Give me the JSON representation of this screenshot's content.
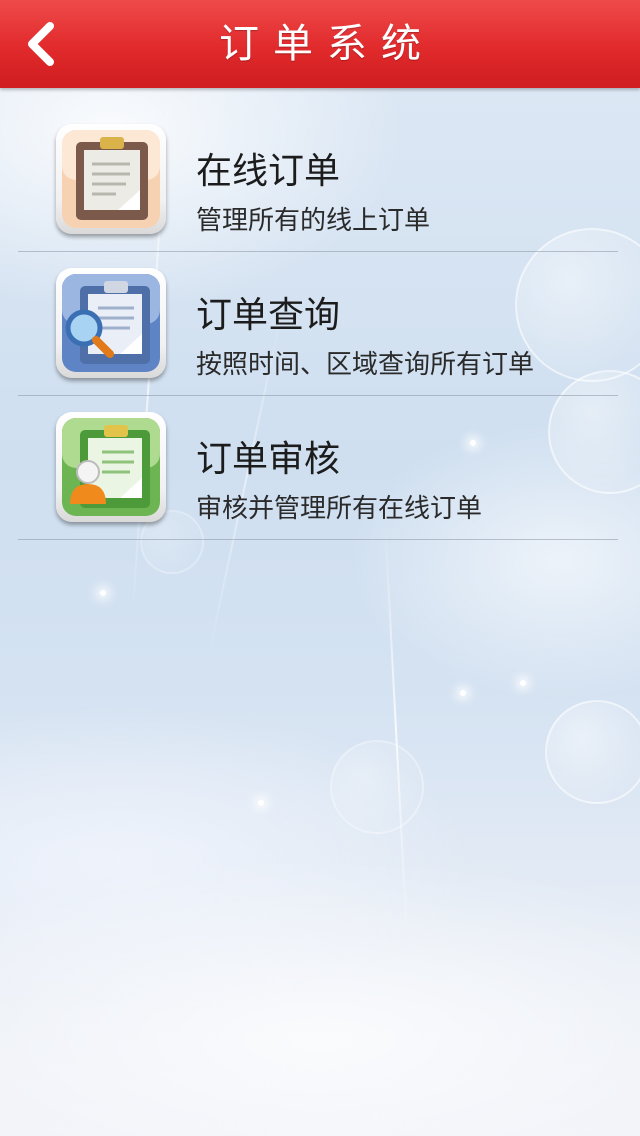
{
  "header": {
    "title": "订单系统",
    "back_icon": "chevron-left-icon",
    "color": "#e12a2c"
  },
  "menu": {
    "items": [
      {
        "id": "online-orders",
        "title": "在线订单",
        "subtitle": "管理所有的线上订单",
        "icon": "clipboard-document-icon",
        "icon_color": "#f3c9a6"
      },
      {
        "id": "order-query",
        "title": "订单查询",
        "subtitle": "按照时间、区域查询所有订单",
        "icon": "clipboard-search-icon",
        "icon_color": "#6f8fc8"
      },
      {
        "id": "order-review",
        "title": "订单审核",
        "subtitle": "审核并管理所有在线订单",
        "icon": "clipboard-user-icon",
        "icon_color": "#7cc064"
      }
    ]
  }
}
